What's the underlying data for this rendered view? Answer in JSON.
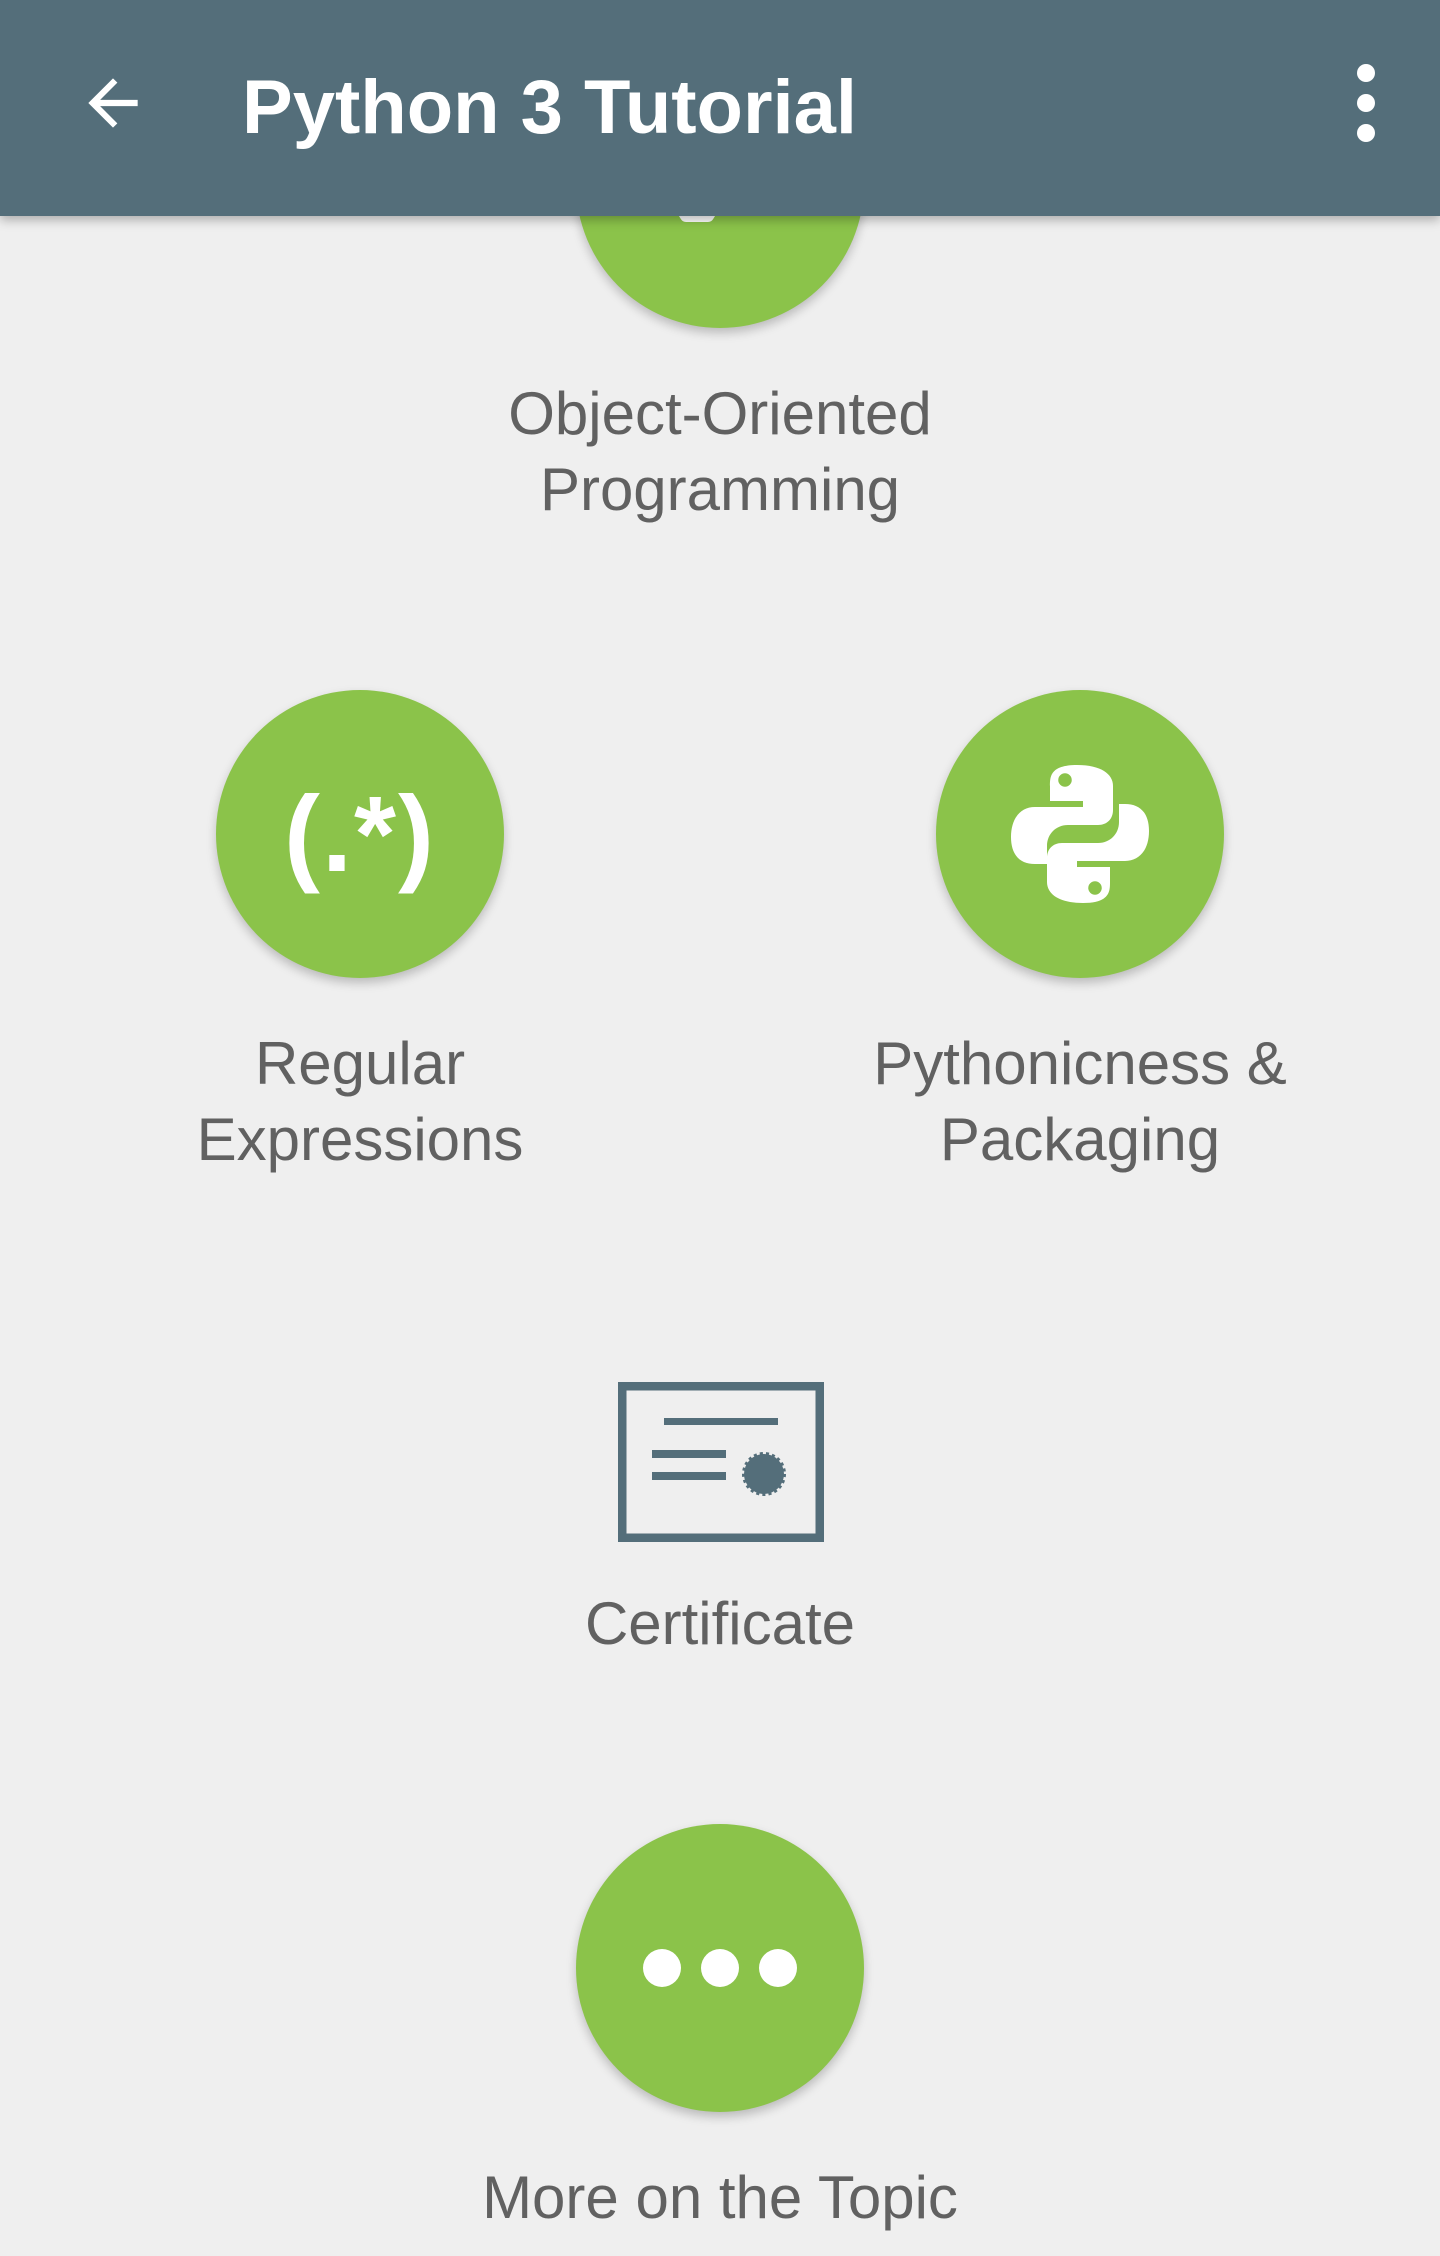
{
  "app_bar": {
    "title": "Python 3 Tutorial"
  },
  "lessons": {
    "oop": {
      "label_line1": "Object-Oriented",
      "label_line2": "Programming",
      "icon": "object-oriented-icon"
    },
    "regex": {
      "label_line1": "Regular",
      "label_line2": "Expressions",
      "glyph": "(.*)",
      "icon": "regex-icon"
    },
    "pythonic": {
      "label_line1": "Pythonicness &",
      "label_line2": "Packaging",
      "icon": "python-logo-icon"
    },
    "certificate": {
      "label": "Certificate",
      "icon": "certificate-icon"
    },
    "more": {
      "label": "More on the Topic",
      "icon": "more-dots-icon"
    }
  },
  "colors": {
    "app_bar": "#546e7a",
    "accent_green": "#8bc34a",
    "background": "#efefef",
    "text_gray": "#616161"
  }
}
